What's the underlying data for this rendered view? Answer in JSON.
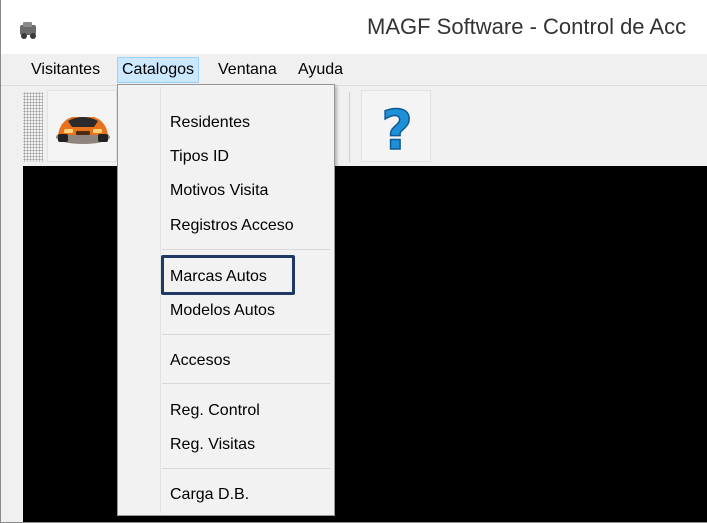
{
  "window": {
    "title": "MAGF Software - Control de Acc"
  },
  "menubar": {
    "items": [
      "Visitantes",
      "Catalogos",
      "Ventana",
      "Ayuda"
    ],
    "active": "Catalogos"
  },
  "toolbar": {
    "buttons": [
      {
        "icon": "sports-car-icon"
      },
      {
        "icon": "help-question-icon"
      }
    ]
  },
  "catalogos_menu": {
    "groups": [
      [
        "Residentes",
        "Tipos ID",
        "Motivos Visita",
        "Registros Acceso"
      ],
      [
        "Marcas Autos",
        "Modelos Autos"
      ],
      [
        "Accesos"
      ],
      [
        "Reg. Control",
        "Reg. Visitas"
      ],
      [
        "Carga D.B."
      ]
    ],
    "highlighted_item": "Marcas Autos"
  },
  "colors": {
    "highlight_border": "#1f3864",
    "help_icon": "#1e90d8",
    "car_body": "#e8731c",
    "client_area": "#000000",
    "active_menu_bg": "#cce8ff"
  }
}
